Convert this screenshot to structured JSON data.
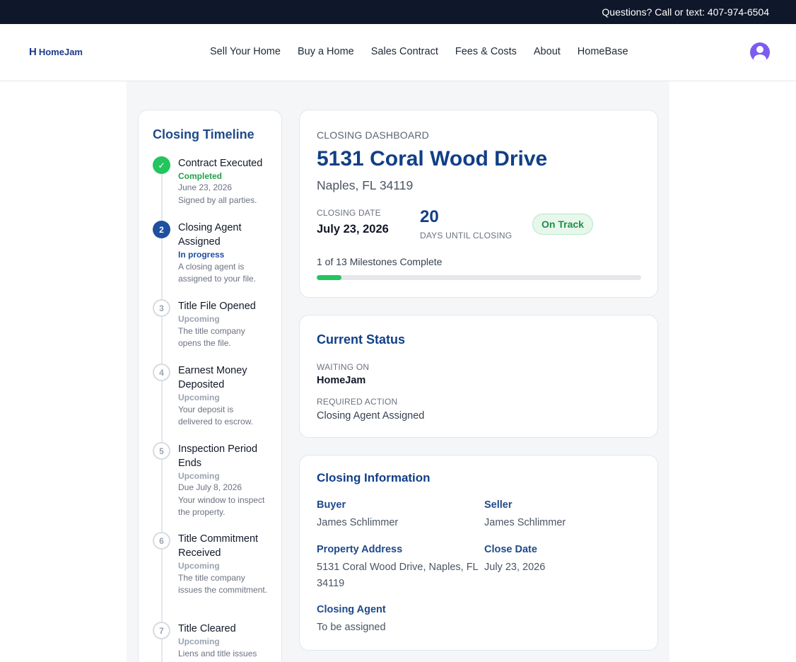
{
  "topbar": {
    "contact": "Questions? Call or text: 407-974-6504"
  },
  "brand": {
    "mark": "H",
    "name": "HomeJam"
  },
  "nav": {
    "items": [
      "Sell Your Home",
      "Buy a Home",
      "Sales Contract",
      "Fees & Costs",
      "About",
      "HomeBase"
    ]
  },
  "timeline": {
    "title": "Closing Timeline",
    "steps": [
      {
        "marker": "✓",
        "title": "Contract Executed",
        "status": "Completed",
        "date": "June 23, 2026",
        "desc": "Signed by all parties."
      },
      {
        "marker": "2",
        "title": "Closing Agent Assigned",
        "status": "In progress",
        "desc": "A closing agent is assigned to your file."
      },
      {
        "marker": "3",
        "title": "Title File Opened",
        "status": "Upcoming",
        "desc": "The title company opens the file."
      },
      {
        "marker": "4",
        "title": "Earnest Money Deposited",
        "status": "Upcoming",
        "desc": "Your deposit is delivered to escrow."
      },
      {
        "marker": "5",
        "title": "Inspection Period Ends",
        "status": "Upcoming",
        "date": "Due July 8, 2026",
        "desc": "Your window to inspect the property."
      },
      {
        "marker": "6",
        "title": "Title Commitment Received",
        "status": "Upcoming",
        "desc": "The title company issues the commitment."
      },
      {
        "marker": "7",
        "title": "Title Cleared",
        "status": "Upcoming",
        "desc": "Liens and title issues"
      }
    ]
  },
  "dashboard": {
    "eyebrow": "CLOSING DASHBOARD",
    "address": "5131 Coral Wood Drive",
    "city": "Naples, FL 34119",
    "closing_date_label": "CLOSING DATE",
    "closing_date": "July 23, 2026",
    "days": "20",
    "days_label": "DAYS UNTIL CLOSING",
    "badge": "On Track",
    "milestones_text": "1 of 13 Milestones Complete",
    "progress_fraction": 0.077,
    "colors": {
      "progress": "#22c55e",
      "accent": "#113f86"
    }
  },
  "current_status": {
    "title": "Current Status",
    "waiting_label": "WAITING ON",
    "waiting_value": "HomeJam",
    "action_label": "REQUIRED ACTION",
    "action_value": "Closing Agent Assigned"
  },
  "closing_info": {
    "title": "Closing Information",
    "buyer_label": "Buyer",
    "buyer": "James Schlimmer",
    "seller_label": "Seller",
    "seller": "James Schlimmer",
    "property_label": "Property Address",
    "property_line1": "5131 Coral Wood Drive, Naples, FL",
    "property_line2": "34119",
    "close_date_label": "Close Date",
    "close_date": "July 23, 2026",
    "agent_label": "Closing Agent",
    "agent": "To be assigned"
  }
}
